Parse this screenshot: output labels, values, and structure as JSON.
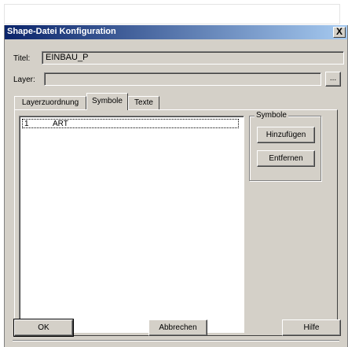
{
  "window": {
    "title": "Shape-Datei Konfiguration",
    "close_glyph": "X"
  },
  "fields": {
    "title_label": "Titel:",
    "title_value": "EINBAU_P",
    "layer_label": "Layer:",
    "layer_value": "",
    "browse_label": "..."
  },
  "tabs": [
    {
      "label": "Layerzuordnung",
      "active": false
    },
    {
      "label": "Symbole",
      "active": true
    },
    {
      "label": "Texte",
      "active": false
    }
  ],
  "symbols": {
    "list": [
      {
        "index": "1",
        "name": "ART"
      }
    ],
    "group_title": "Symbole",
    "add_label": "Hinzufügen",
    "remove_label": "Entfernen"
  },
  "footer": {
    "ok_label": "OK",
    "cancel_label": "Abbrechen",
    "help_label": "Hilfe"
  },
  "colors": {
    "titlebar_start": "#0a246a",
    "titlebar_end": "#a6caf0",
    "face": "#d4d0c8"
  }
}
